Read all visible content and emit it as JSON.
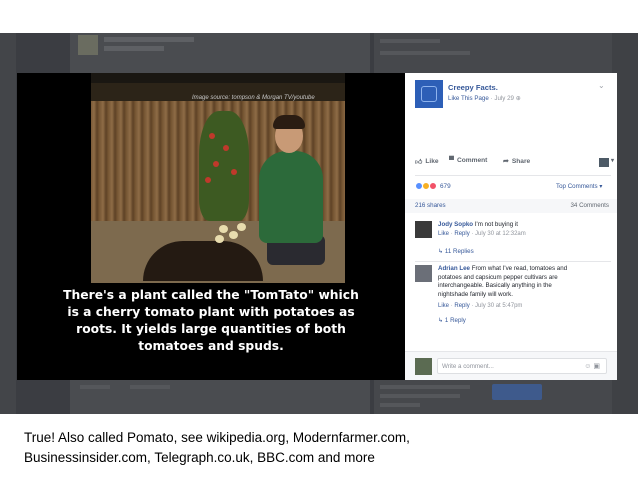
{
  "photo": {
    "image_source": "Image source: tompson & Morgan TV/youtube",
    "caption_lines": [
      "There's a plant called the \"TomTato\" which",
      "is a cherry tomato plant with potatoes as",
      "roots. It yields large quantities of both",
      "tomatoes and spuds."
    ]
  },
  "panel": {
    "page_name": "Creepy Facts.",
    "like_this_page": "Like This Page",
    "post_date": "July 29",
    "actions": {
      "like": "Like",
      "comment": "Comment",
      "share": "Share"
    },
    "reaction_count": "679",
    "top_comments": "Top Comments",
    "shares": "216 shares",
    "comments_count": "34 Comments",
    "comments": [
      {
        "name": "Jody Sopko",
        "text": "I'm not buying it",
        "like": "Like",
        "reply": "Reply",
        "timestamp": "July 30 at 12:32am",
        "replies": "11 Replies"
      },
      {
        "name": "Adrian Lee",
        "text_lines": [
          "From what I've read, tomatoes and",
          "potatoes and capsicum pepper cultivars are",
          "interchangeable. Basically anything in the",
          "nightshade family will work."
        ],
        "like": "Like",
        "reply": "Reply",
        "timestamp": "July 30 at 5:47pm",
        "replies": "1 Reply"
      }
    ],
    "write_placeholder": "Write a comment..."
  },
  "footer": {
    "line1": "True! Also called Pomato, see wikipedia.org, Modernfarmer.com,",
    "line2": "Businessinsider.com, Telegraph.co.uk, BBC.com and more"
  },
  "colors": {
    "facebook_blue": "#365899",
    "backdrop": "#3b3d42",
    "page_logo": "#2d5fb7"
  }
}
